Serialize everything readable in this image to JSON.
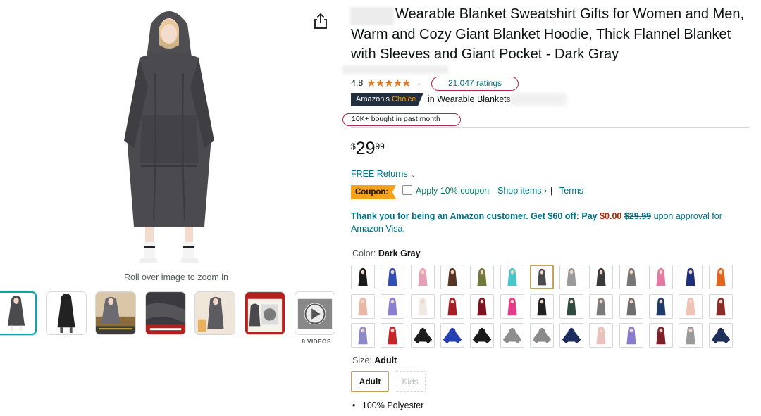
{
  "gallery": {
    "zoom_hint": "Roll over image to zoom in",
    "videos_label": "8 VIDEOS",
    "thumbnails": [
      "gray-hoodie",
      "black-hoodie",
      "lifestyle-1",
      "fabric-closeup",
      "lifestyle-2",
      "washer-info",
      "video"
    ]
  },
  "product": {
    "title": "Wearable Blanket Sweatshirt Gifts for Women and Men, Warm and Cozy Giant Blanket Hoodie, Thick Flannel Blanket with Sleeves and Giant Pocket - Dark Gray",
    "rating": "4.8",
    "stars": "★★★★★",
    "ratings_count": "21,047 ratings",
    "choice_badge_main": "Amazon's",
    "choice_badge_accent": "Choice",
    "choice_category": "in Wearable Blankets",
    "bought": "10K+ bought in past month",
    "price": {
      "symbol": "$",
      "whole": "29",
      "fraction": "99"
    },
    "returns": "FREE Returns",
    "coupon": {
      "badge": "Coupon:",
      "text": "Apply 10% coupon",
      "shop_items": "Shop items ›",
      "separator": "|",
      "terms": "Terms"
    },
    "visa_offer": {
      "lead": "Thank you for being an Amazon customer. Get $60 off: Pay",
      "pay": "$0.00",
      "strike": "$29.99",
      "tail": "upon approval for Amazon Visa."
    },
    "color": {
      "label": "Color:",
      "value": "Dark Gray"
    },
    "size": {
      "label": "Size:",
      "value": "Adult",
      "options": [
        "Adult",
        "Kids"
      ]
    },
    "bullets": [
      "100% Polyester"
    ]
  },
  "colors": {
    "accent_star": "#de7921",
    "link": "#007185",
    "coupon_green": "#067d62",
    "price_red": "#b12704",
    "badge_bg": "#232f3e",
    "coupon_orange": "#f7a21b",
    "highlight_circle": "#b4254a"
  },
  "swatch_colors": [
    [
      "#1b1b1b",
      "#2f4fb7",
      "#e6a0b5",
      "#5a3523",
      "#6f7a3a",
      "#49c6c7",
      "#4a4a4f",
      "#9a9a9a",
      "#3a3a3a",
      "#777777",
      "#e27aa4",
      "#1d2e7a",
      "#e0651e"
    ],
    [
      "#e9b7a8",
      "#8a7fd0",
      "#f0e9e2",
      "#a31e27",
      "#7d1321",
      "#e43b8c",
      "#222222",
      "#2f4a3e",
      "#7a7a7a",
      "#6e6e6e",
      "#1f3a6b",
      "#f1c3b6",
      "#8c2a2a"
    ],
    [
      "#8d88c7",
      "#c62629",
      "#1c1c1c",
      "#2541b2",
      "#1a1a1a",
      "#8e8e8e",
      "#8a8a8a",
      "#1c2d5e",
      "#e9c2bd",
      "#8b7bd0",
      "#7f1f2b",
      "#9a9a9a",
      "#1e2f5a"
    ]
  ]
}
